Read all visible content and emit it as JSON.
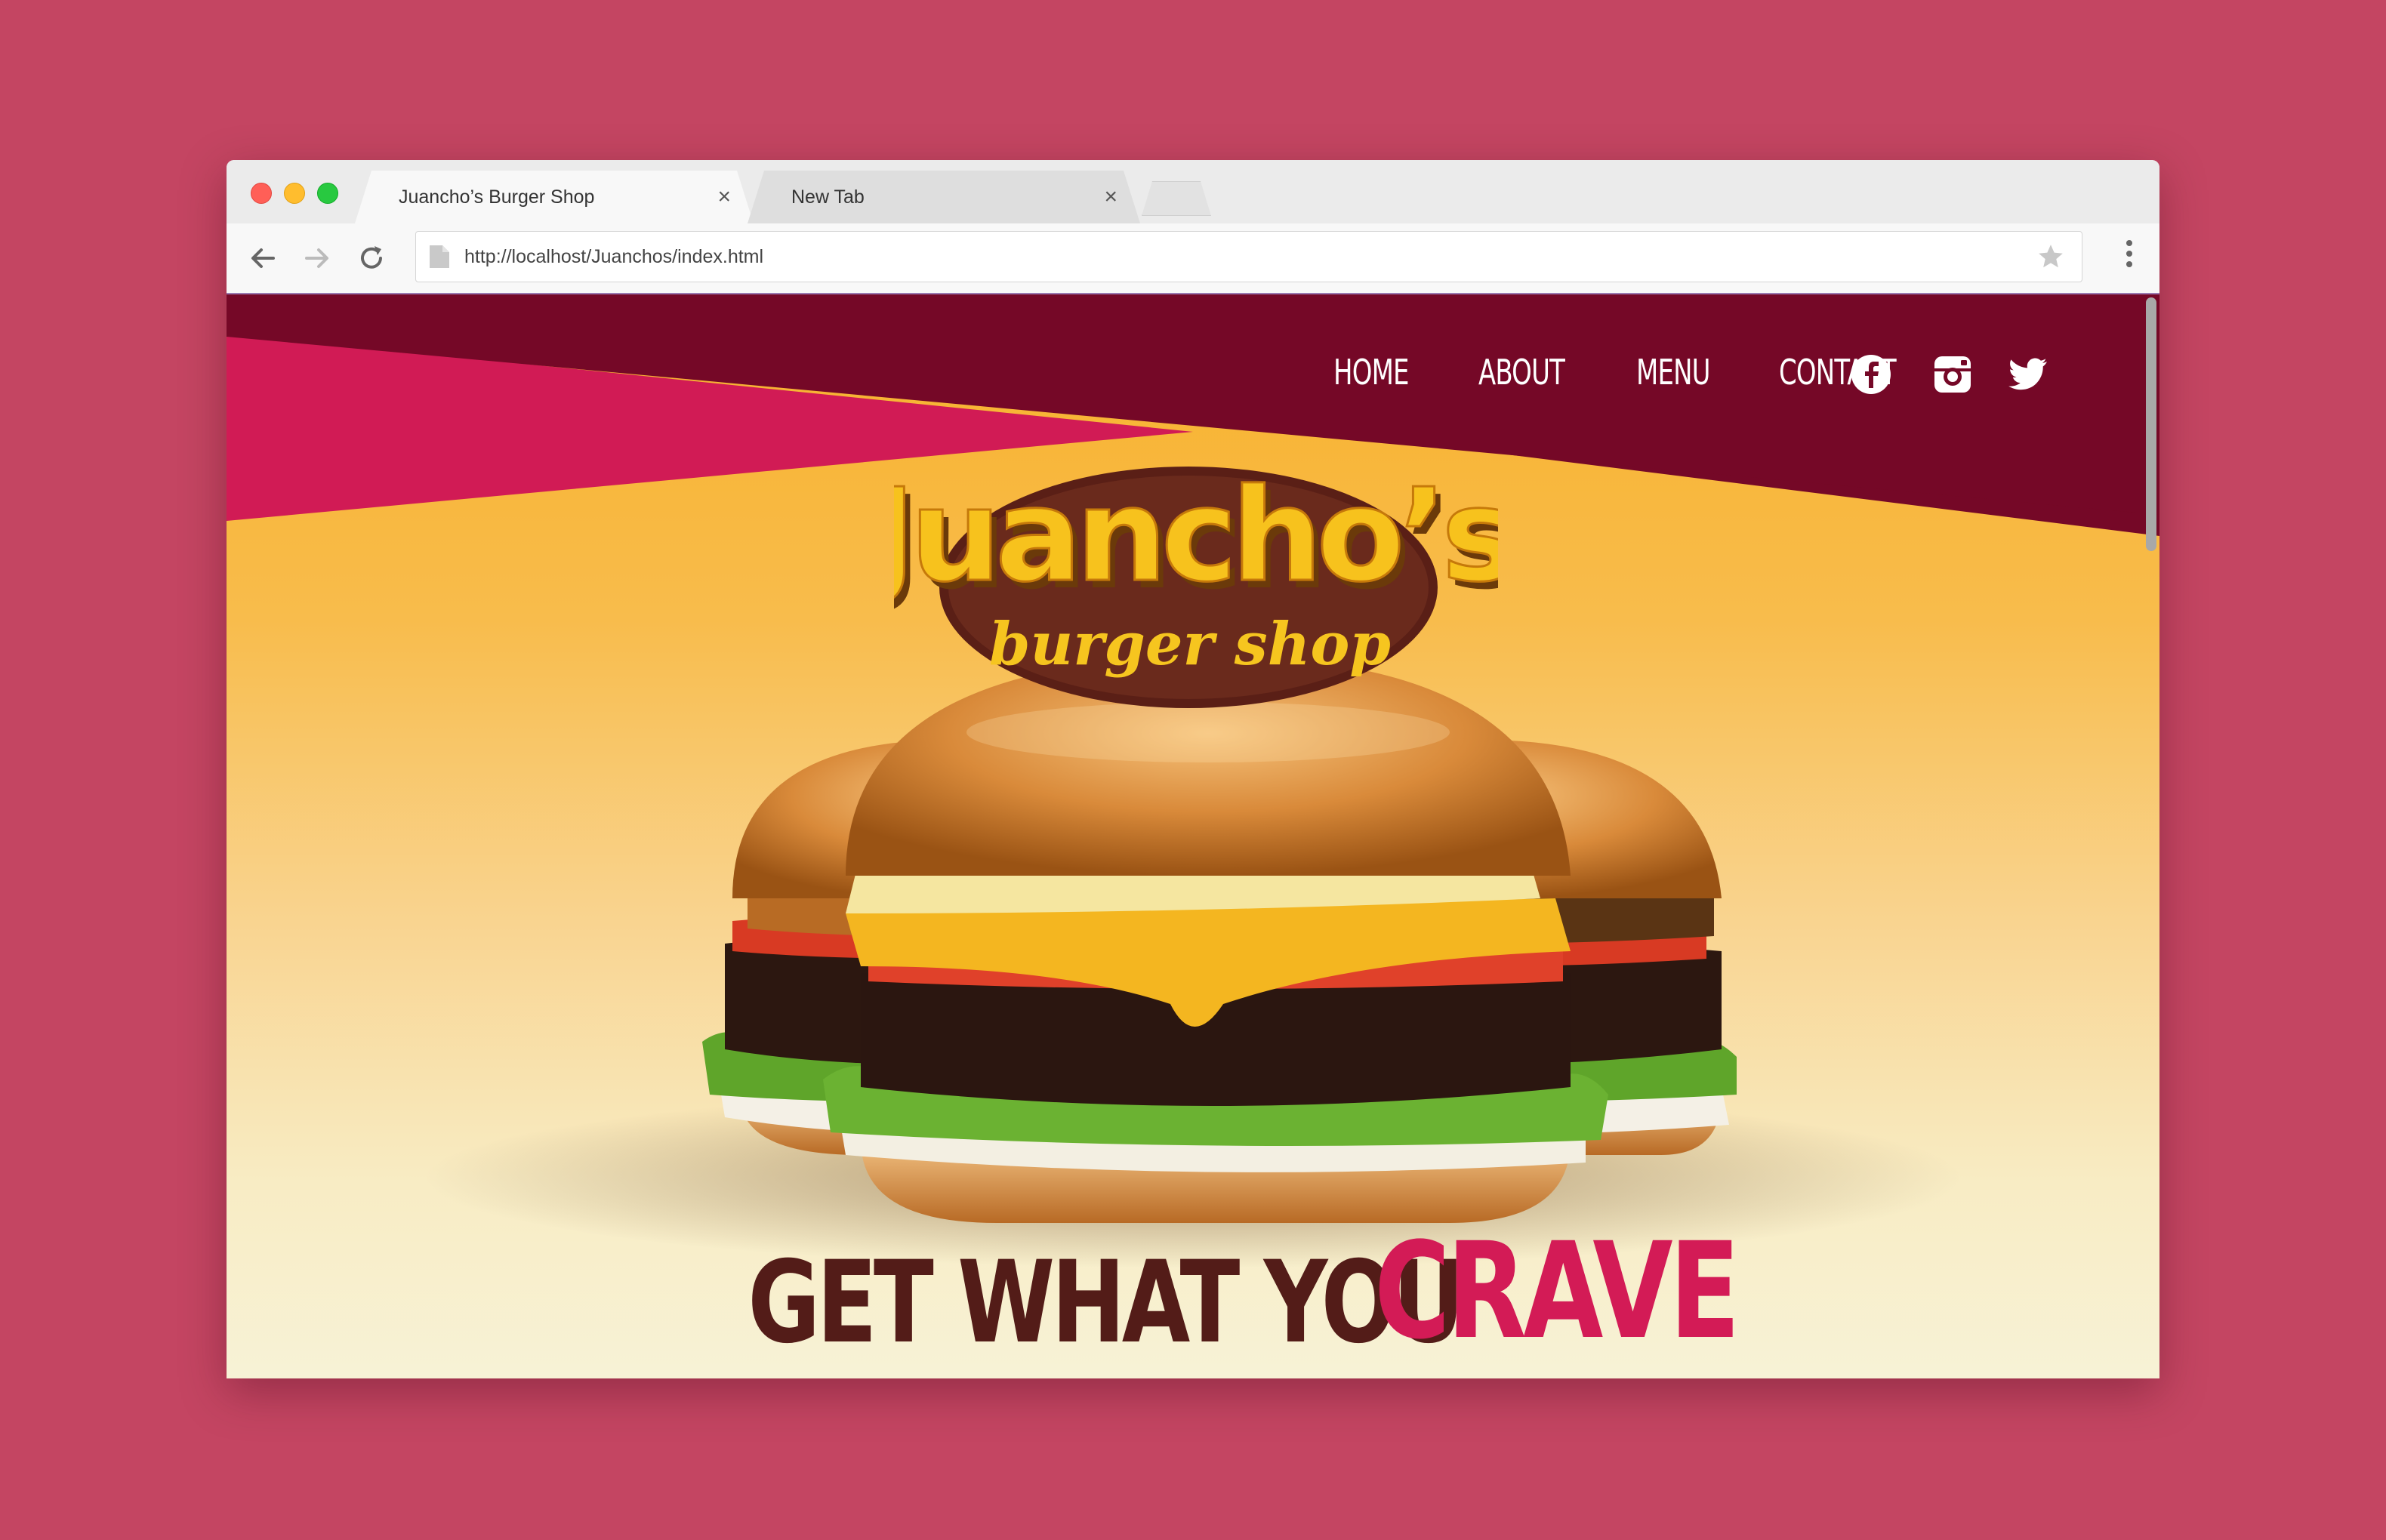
{
  "browser": {
    "tabs": [
      {
        "title": "Juancho’s Burger Shop",
        "active": true
      },
      {
        "title": "New Tab",
        "active": false
      }
    ],
    "close_glyph": "×",
    "address": "http://localhost/Juanchos/index.html",
    "icons": [
      "arrow-left-icon",
      "arrow-right-icon",
      "reload-icon",
      "page-icon",
      "star-icon",
      "more-vert-icon"
    ]
  },
  "site": {
    "nav": [
      "HOME",
      "ABOUT",
      "MENU",
      "CONTACT"
    ],
    "social": [
      "facebook-icon",
      "instagram-icon",
      "twitter-icon"
    ],
    "logo": {
      "line1": "Juancho’s",
      "line2": "burger shop"
    },
    "headline": {
      "main": "GET WHAT YOU",
      "accent": "CRAVE"
    }
  },
  "colors": {
    "backdrop": "#c44562",
    "header_dark": "#750827",
    "header_pink": "#d11b55",
    "accent": "#d31b56",
    "headline_dark": "#531c18",
    "hero_top": "#f7b12a",
    "hero_bottom": "#f7f2d6"
  }
}
